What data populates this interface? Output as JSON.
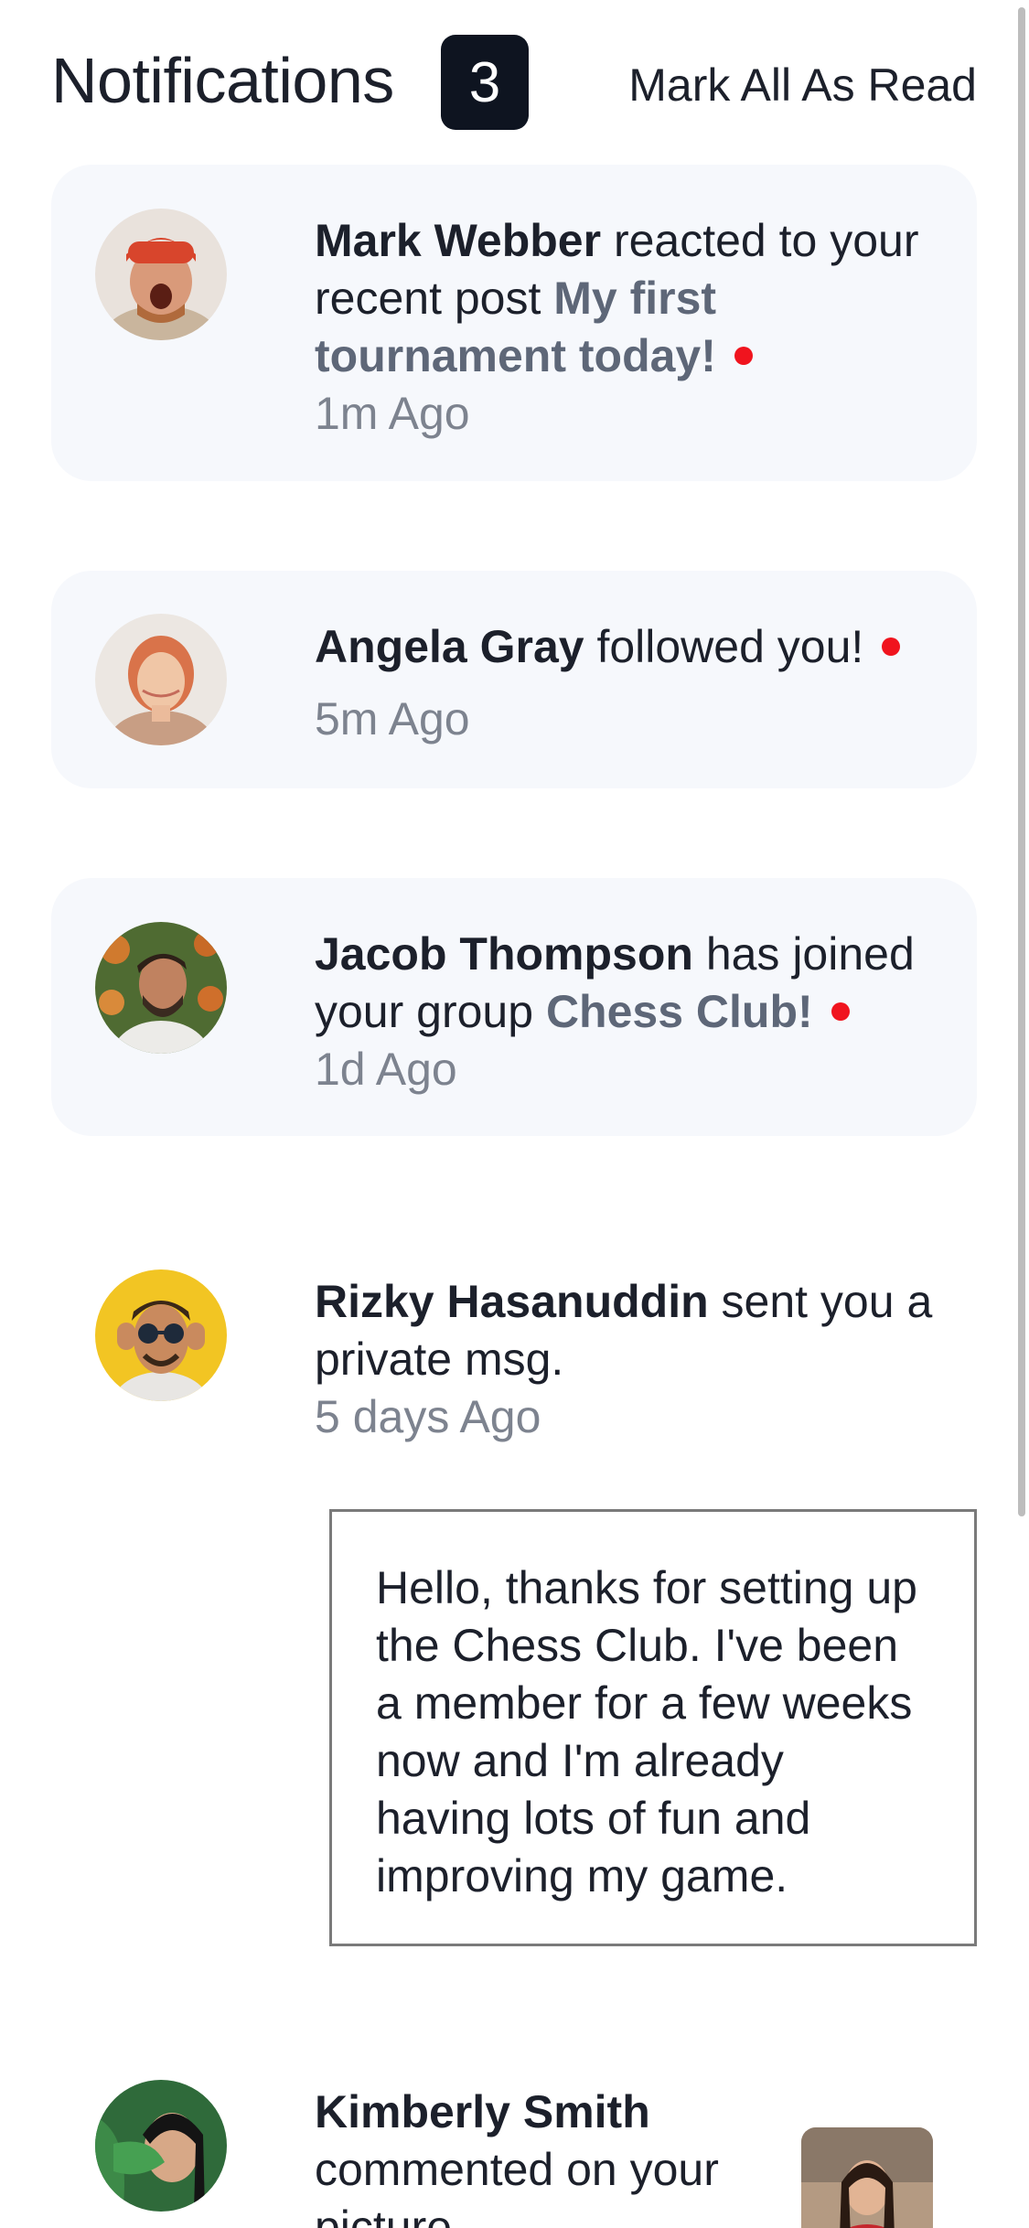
{
  "header": {
    "title": "Notifications",
    "unread_count": "3",
    "mark_all_label": "Mark All As Read"
  },
  "notifications": [
    {
      "name": "Mark Webber",
      "action": " reacted to your recent post ",
      "target": "My first tournament today!",
      "time": "1m Ago",
      "unread": true
    },
    {
      "name": "Angela Gray",
      "action": " followed you!",
      "target": "",
      "time": "5m Ago",
      "unread": true
    },
    {
      "name": "Jacob Thompson",
      "action": " has joined your group ",
      "target": "Chess Club!",
      "time": "1d Ago",
      "unread": true
    },
    {
      "name": "Rizky Hasanuddin",
      "action": " sent you a private msg.",
      "target": "",
      "time": "5 days Ago",
      "unread": false,
      "message": "Hello, thanks for setting up the Chess Club. I've been a member for a few weeks now and I'm already having lots of fun and improving my game."
    },
    {
      "name": "Kimberly Smith",
      "action": " commented on your picture",
      "target": "",
      "time": "",
      "unread": false
    }
  ],
  "colors": {
    "unread_card_bg": "#f6f8fc",
    "badge_bg": "#0e1420",
    "unread_dot": "#f0141e",
    "post_link": "#5e6778",
    "muted_text": "#7d838f"
  },
  "icons": [
    "unread-dot-icon",
    "avatar-mark-webber",
    "avatar-angela-gray",
    "avatar-jacob-thompson",
    "avatar-rizky-hasanuddin",
    "avatar-kimberly-smith",
    "picture-thumbnail"
  ]
}
